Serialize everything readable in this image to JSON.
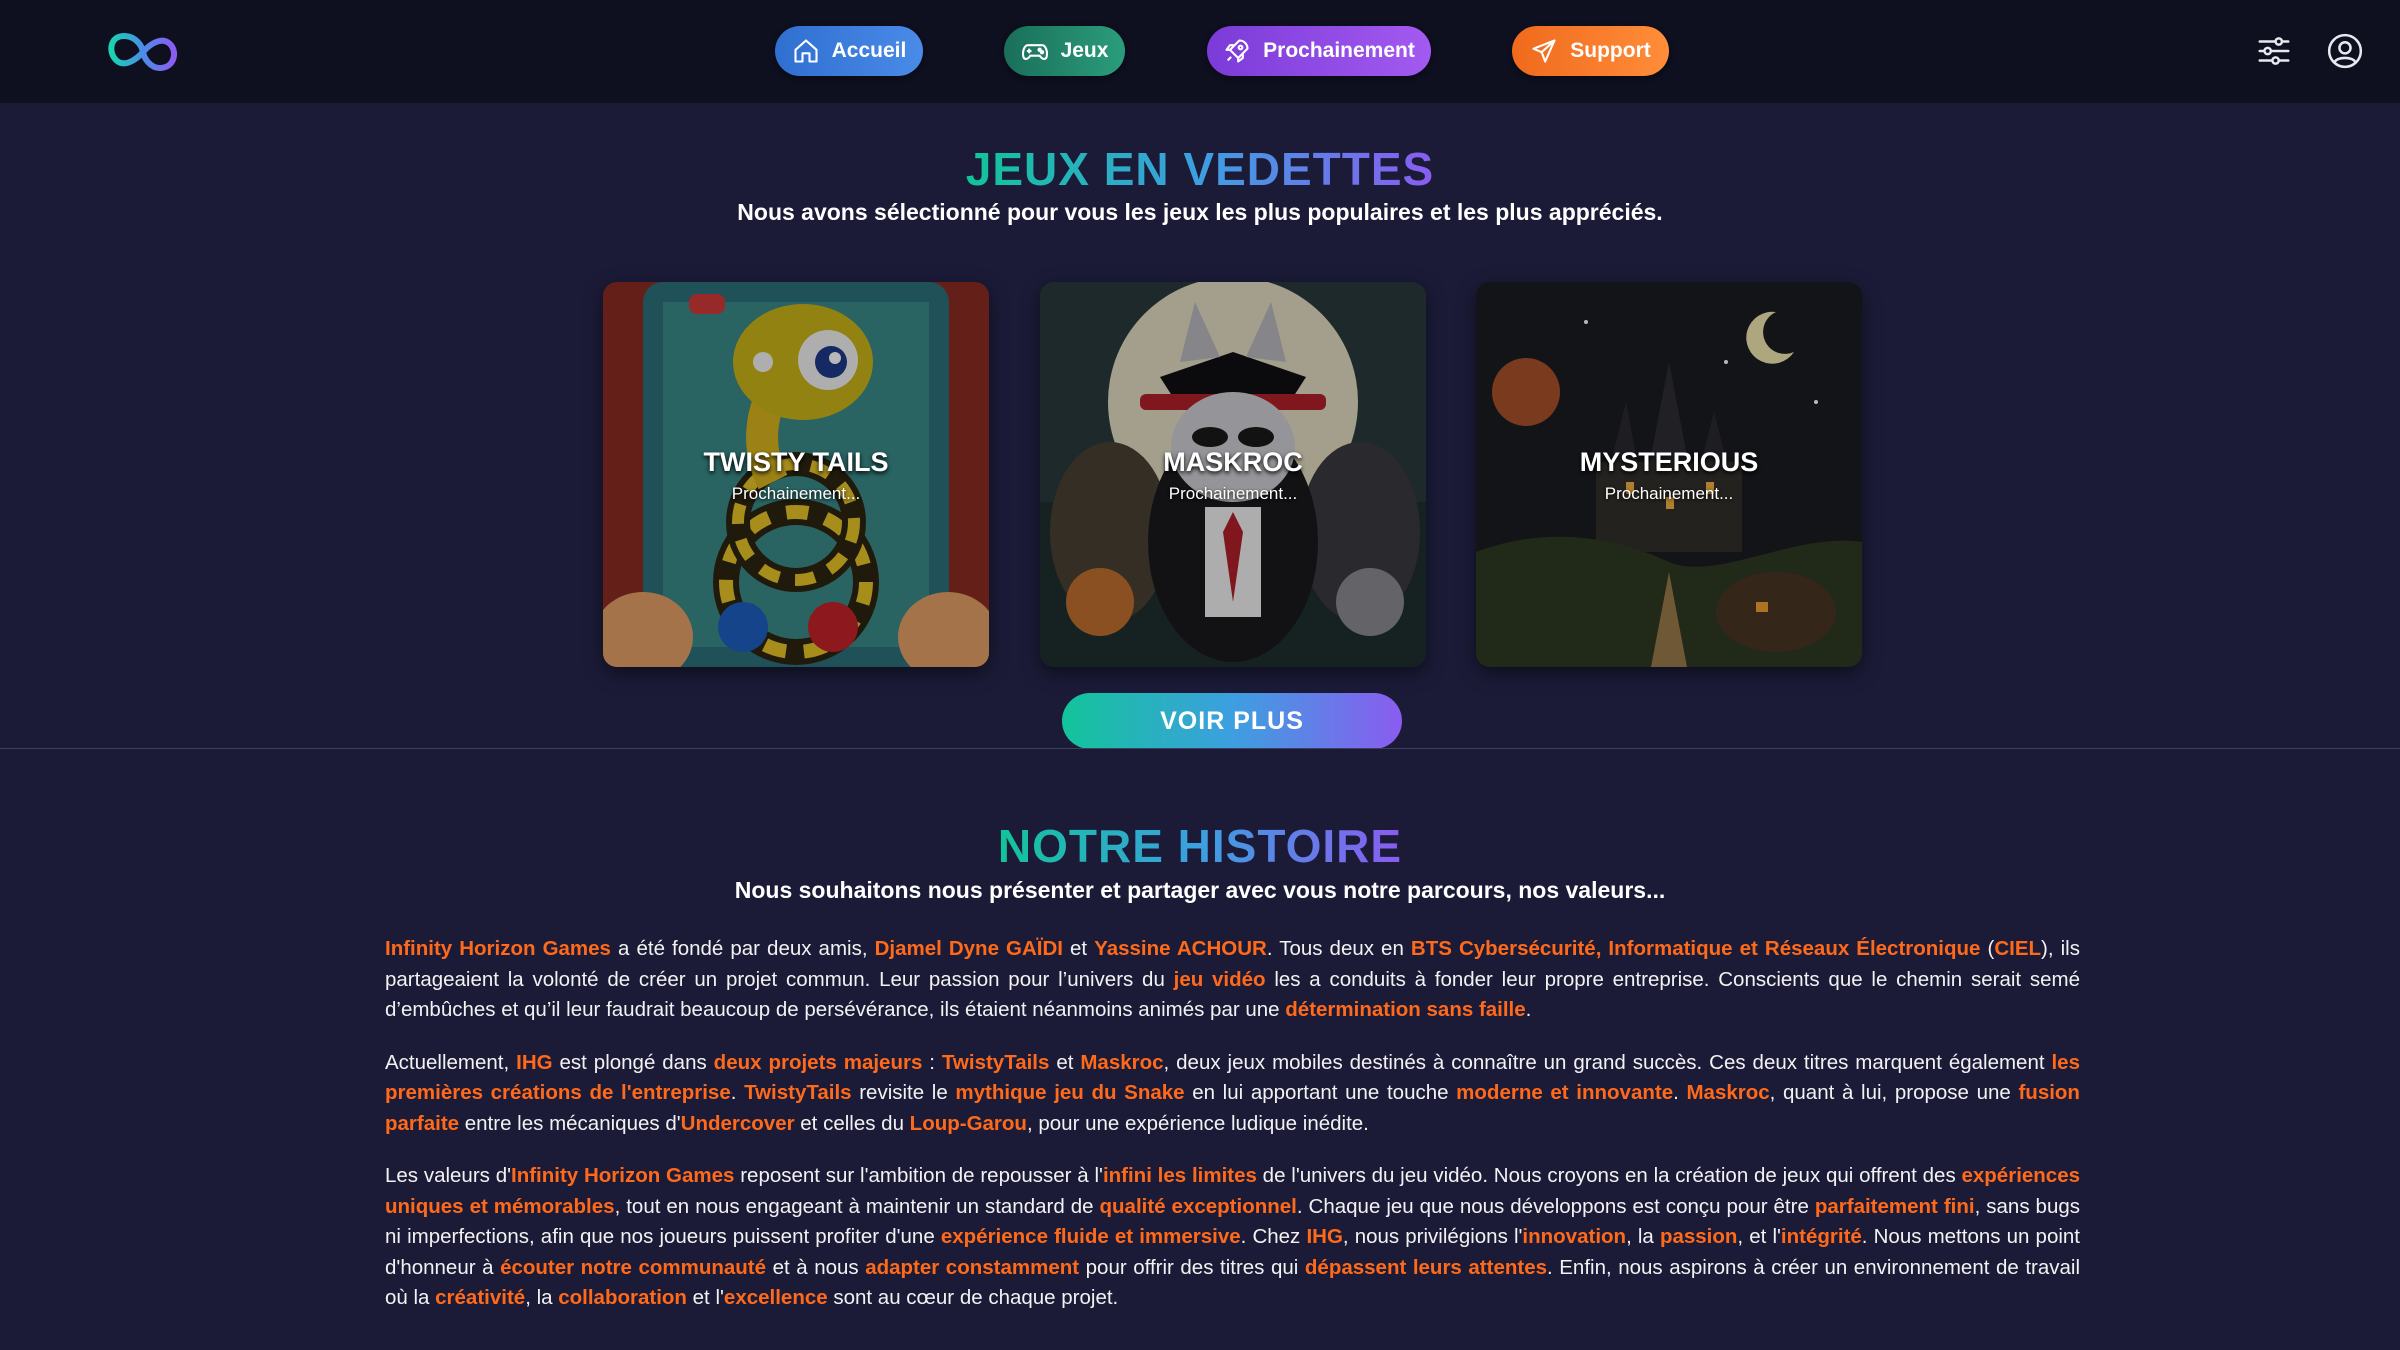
{
  "nav": {
    "accueil": "Accueil",
    "jeux": "Jeux",
    "prochainement": "Prochainement",
    "support": "Support"
  },
  "featured": {
    "title": "JEUX EN VEDETTES",
    "subtitle": "Nous avons sélectionné pour vous les jeux les plus populaires et les plus appréciés.",
    "cards": [
      {
        "title": "TWISTY TAILS",
        "status": "Prochainement..."
      },
      {
        "title": "MASKROC",
        "status": "Prochainement..."
      },
      {
        "title": "MYSTERIOUS",
        "status": "Prochainement..."
      }
    ],
    "more_button": "VOIR PLUS"
  },
  "history": {
    "title": "NOTRE HISTOIRE",
    "subtitle": "Nous souhaitons nous présenter et partager avec vous notre parcours, nos valeurs...",
    "p1": [
      {
        "t": "Infinity Horizon Games",
        "h": true
      },
      {
        "t": " a été fondé par deux amis, "
      },
      {
        "t": "Djamel Dyne GAÏDI",
        "h": true
      },
      {
        "t": " et "
      },
      {
        "t": "Yassine ACHOUR",
        "h": true
      },
      {
        "t": ". Tous deux en "
      },
      {
        "t": "BTS Cybersécurité, Informatique et Réseaux Électronique",
        "h": true
      },
      {
        "t": " ("
      },
      {
        "t": "CIEL",
        "h": true
      },
      {
        "t": "), ils partageaient la volonté de créer un projet commun. Leur passion pour l’univers du "
      },
      {
        "t": "jeu vidéo",
        "h": true
      },
      {
        "t": " les a conduits à fonder leur propre entreprise. Conscients que le chemin serait semé d’embûches et qu’il leur faudrait beaucoup de persévérance, ils étaient néanmoins animés par une "
      },
      {
        "t": "détermination sans faille",
        "h": true
      },
      {
        "t": "."
      }
    ],
    "p2": [
      {
        "t": "Actuellement, "
      },
      {
        "t": "IHG",
        "h": true
      },
      {
        "t": " est plongé dans "
      },
      {
        "t": "deux projets majeurs",
        "h": true
      },
      {
        "t": " : "
      },
      {
        "t": "TwistyTails",
        "h": true
      },
      {
        "t": " et "
      },
      {
        "t": "Maskroc",
        "h": true
      },
      {
        "t": ", deux jeux mobiles destinés à connaître un grand succès. Ces deux titres marquent également "
      },
      {
        "t": "les premières créations de l'entreprise",
        "h": true
      },
      {
        "t": ". "
      },
      {
        "t": "TwistyTails",
        "h": true
      },
      {
        "t": " revisite le "
      },
      {
        "t": "mythique jeu du Snake",
        "h": true
      },
      {
        "t": " en lui apportant une touche "
      },
      {
        "t": "moderne et innovante",
        "h": true
      },
      {
        "t": ". "
      },
      {
        "t": "Maskroc",
        "h": true
      },
      {
        "t": ", quant à lui, propose une "
      },
      {
        "t": "fusion parfaite",
        "h": true
      },
      {
        "t": " entre les mécaniques d'"
      },
      {
        "t": "Undercover",
        "h": true
      },
      {
        "t": " et celles du "
      },
      {
        "t": "Loup-Garou",
        "h": true
      },
      {
        "t": ", pour une expérience ludique inédite."
      }
    ],
    "p3": [
      {
        "t": "Les valeurs d'"
      },
      {
        "t": "Infinity Horizon Games",
        "h": true
      },
      {
        "t": " reposent sur l'ambition de repousser à l'"
      },
      {
        "t": "infini les limites",
        "h": true
      },
      {
        "t": " de l'univers du jeu vidéo. Nous croyons en la création de jeux qui offrent des "
      },
      {
        "t": "expériences uniques et mémorables",
        "h": true
      },
      {
        "t": ", tout en nous engageant à maintenir un standard de "
      },
      {
        "t": "qualité exceptionnel",
        "h": true
      },
      {
        "t": ". Chaque jeu que nous développons est conçu pour être "
      },
      {
        "t": "parfaitement fini",
        "h": true
      },
      {
        "t": ", sans bugs ni imperfections, afin que nos joueurs puissent profiter d'une "
      },
      {
        "t": "expérience fluide et immersive",
        "h": true
      },
      {
        "t": ". Chez "
      },
      {
        "t": "IHG",
        "h": true
      },
      {
        "t": ", nous privilégions l'"
      },
      {
        "t": "innovation",
        "h": true
      },
      {
        "t": ", la "
      },
      {
        "t": "passion",
        "h": true
      },
      {
        "t": ", et l'"
      },
      {
        "t": "intégrité",
        "h": true
      },
      {
        "t": ". Nous mettons un point d'honneur à "
      },
      {
        "t": "écouter notre communauté",
        "h": true
      },
      {
        "t": " et à nous "
      },
      {
        "t": "adapter constamment",
        "h": true
      },
      {
        "t": " pour offrir des titres qui "
      },
      {
        "t": "dépassent leurs attentes",
        "h": true
      },
      {
        "t": ". Enfin, nous aspirons à créer un environnement de travail où la "
      },
      {
        "t": "créativité",
        "h": true
      },
      {
        "t": ", la "
      },
      {
        "t": "collaboration",
        "h": true
      },
      {
        "t": " et l'"
      },
      {
        "t": "excellence",
        "h": true
      },
      {
        "t": " sont au cœur de chaque projet."
      }
    ]
  },
  "colors": {
    "background": "#1b1b38",
    "navbar": "#0e0f1f",
    "highlight": "#ff6a1a",
    "accueil": "#3b7ddd",
    "jeux": "#23876b",
    "prochainement": "#8f4ae6",
    "support": "#f77a28"
  },
  "icons": {
    "logo": "infinity-logo-icon",
    "accueil": "home-icon",
    "jeux": "gamepad-icon",
    "prochainement": "rocket-icon",
    "support": "paper-plane-icon",
    "settings": "sliders-icon",
    "account": "user-circle-icon"
  }
}
